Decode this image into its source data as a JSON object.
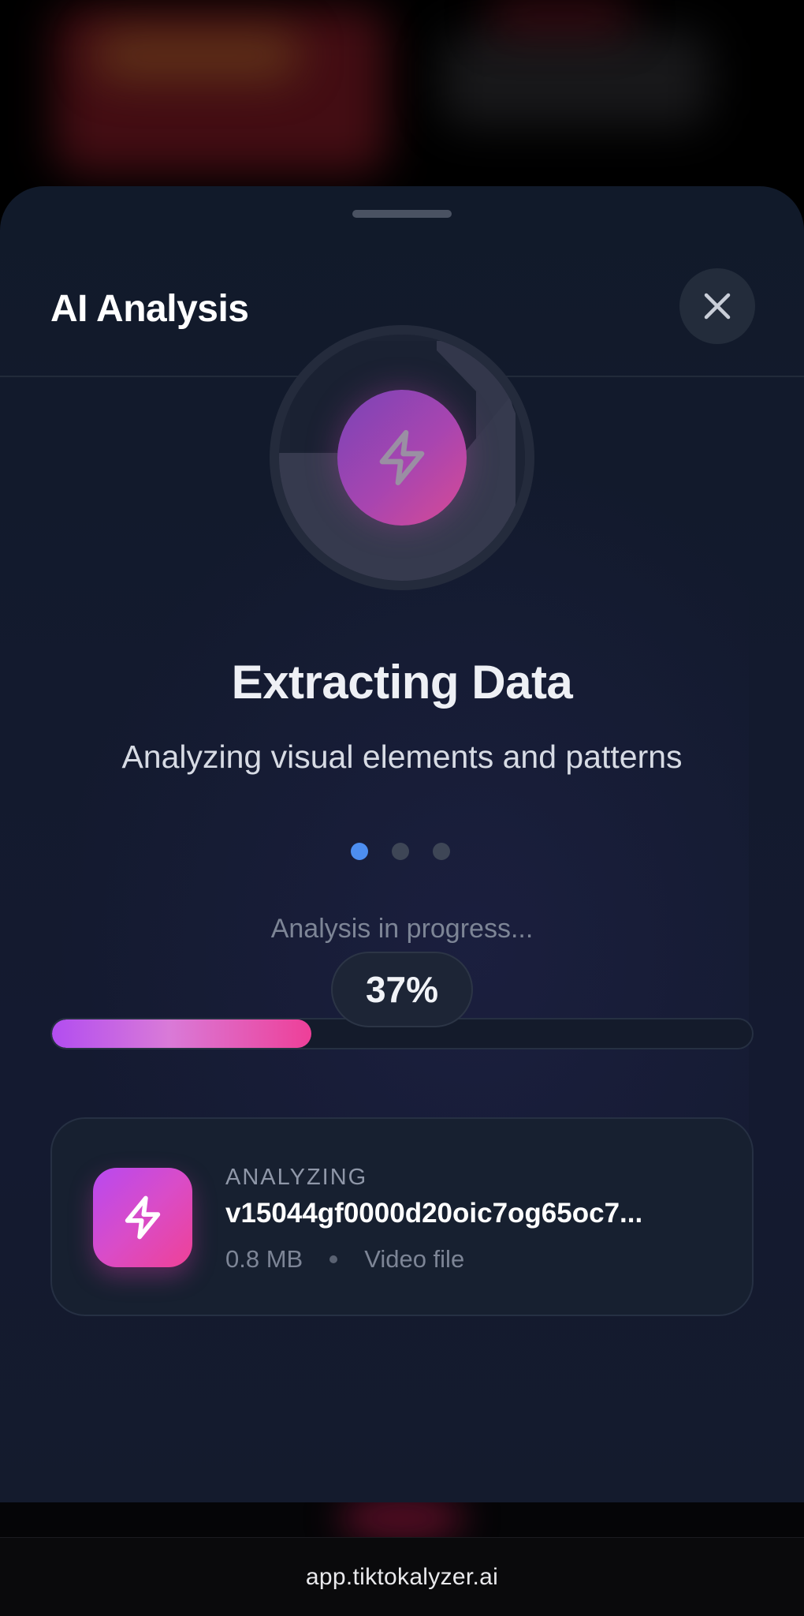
{
  "sheet": {
    "title": "AI Analysis",
    "close_icon": "close-icon"
  },
  "status": {
    "icon": "lightning-bolt-icon",
    "heading": "Extracting Data",
    "subheading": "Analyzing visual elements and patterns",
    "step_dots": {
      "total": 3,
      "active_index": 0
    }
  },
  "progress": {
    "label": "Analysis in progress...",
    "percent_text": "37%",
    "value": 37
  },
  "file": {
    "icon": "lightning-bolt-icon",
    "status": "ANALYZING",
    "name": "v15044gf0000d20oic7og65oc7...",
    "size": "0.8 MB",
    "type": "Video file"
  },
  "browser": {
    "url": "app.tiktokalyzer.ai"
  },
  "colors": {
    "accent_blue": "#4d8ef0",
    "gradient_start": "#b24df0",
    "gradient_end": "#ee3f98",
    "sheet_background": "#131a2e"
  }
}
